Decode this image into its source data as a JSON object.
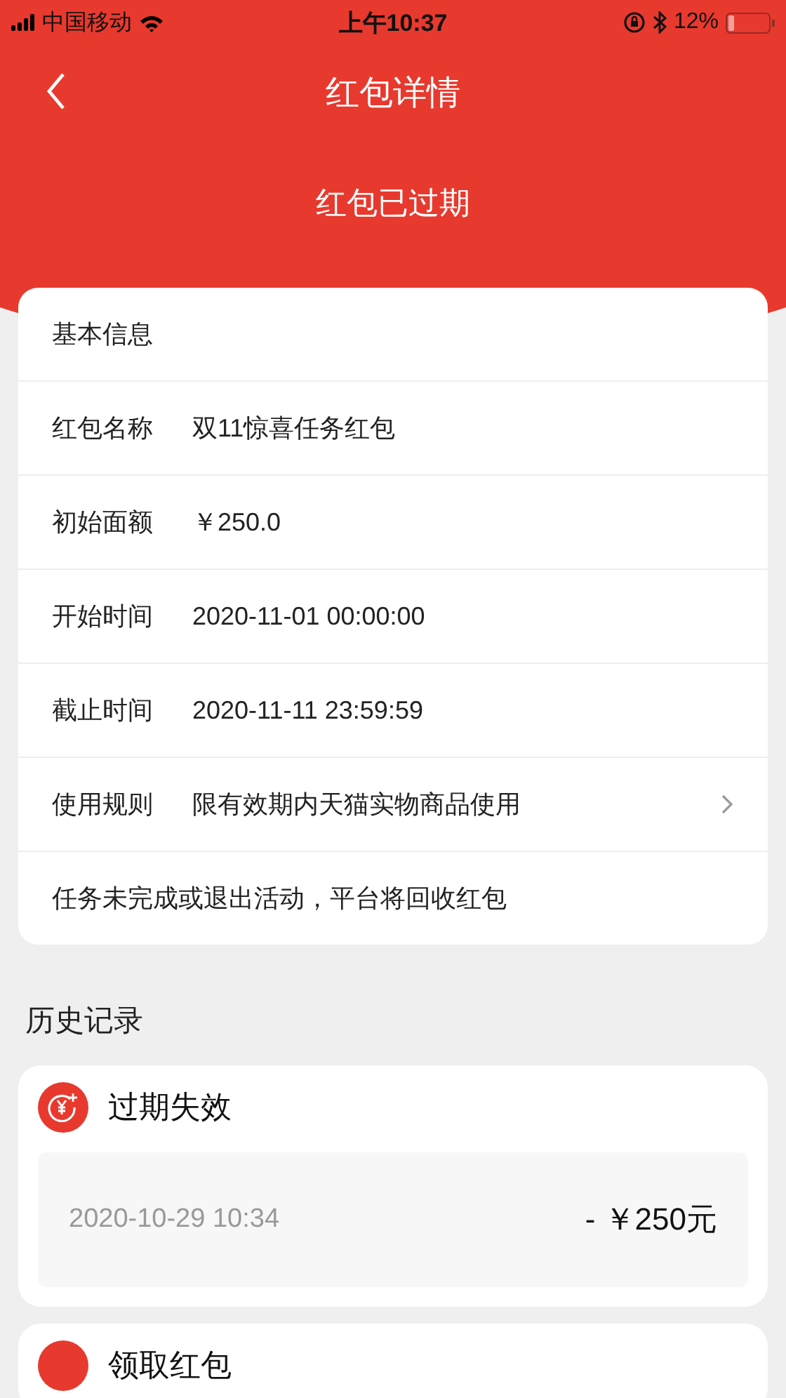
{
  "status_bar": {
    "carrier": "中国移动",
    "time": "上午10:37",
    "battery": "12%"
  },
  "nav": {
    "title": "红包详情"
  },
  "status_text": "红包已过期",
  "basic_info": {
    "title": "基本信息",
    "rows": [
      {
        "label": "红包名称",
        "value": "双11惊喜任务红包",
        "has_arrow": false
      },
      {
        "label": "初始面额",
        "value": "￥250.0",
        "has_arrow": false
      },
      {
        "label": "开始时间",
        "value": "2020-11-01 00:00:00",
        "has_arrow": false
      },
      {
        "label": "截止时间",
        "value": "2020-11-11 23:59:59",
        "has_arrow": false
      },
      {
        "label": "使用规则",
        "value": "限有效期内天猫实物商品使用",
        "has_arrow": true
      }
    ],
    "note": "任务未完成或退出活动，平台将回收红包"
  },
  "history": {
    "title": "历史记录",
    "records": [
      {
        "title": "过期失效",
        "kind": "expired",
        "date": "2020-10-29 10:34",
        "amount": "- ￥250元"
      },
      {
        "title": "领取红包",
        "kind": "received"
      }
    ]
  }
}
